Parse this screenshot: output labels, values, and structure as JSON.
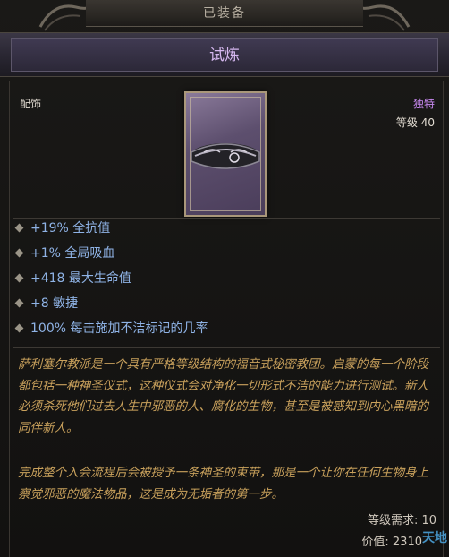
{
  "header": {
    "equipped_label": "已装备"
  },
  "item": {
    "name": "试炼",
    "type": "配饰",
    "rarity": "独特",
    "level_label": "等级 40",
    "affixes": [
      "+19% 全抗值",
      "+1% 全局吸血",
      "+418 最大生命值",
      "+8 敏捷",
      "100% 每击施加不洁标记的几率"
    ],
    "lore_1": "萨利塞尔教派是一个具有严格等级结构的福音式秘密教团。启蒙的每一个阶段都包括一种神圣仪式，这种仪式会对净化一切形式不洁的能力进行测试。新人必须杀死他们过去人生中邪恶的人、腐化的生物，甚至是被感知到内心黑暗的同伴新人。",
    "lore_2": "完成整个入会流程后会被授予一条神圣的束带，那是一个让你在任何生物身上察觉邪恶的魔法物品，这是成为无垢者的第一步。",
    "requirement": "等级需求: 10",
    "price": "价值: 2310"
  },
  "watermark": "天地",
  "colors": {
    "unique_purple": "#c688ee",
    "affix_blue": "#8fb3e6",
    "lore_gold": "#c9a15c"
  }
}
